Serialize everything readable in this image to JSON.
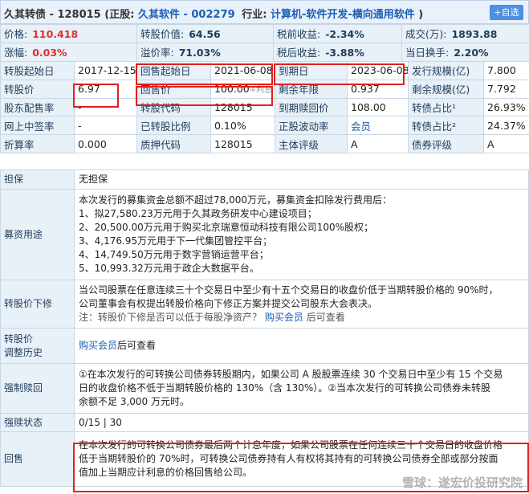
{
  "header": {
    "bond_name": "久其转债 - 128015",
    "stock_prefix": "(正股:",
    "stock": "久其软件 - 002279",
    "industry_label": "行业:",
    "industry": "计算机-软件开发-横向通用软件",
    "industry_suffix": ")",
    "add_watch": "+自选"
  },
  "quote_rows": [
    [
      {
        "l": "价格:",
        "v": "110.418",
        "c": "red"
      },
      {
        "l": "转股价值:",
        "v": "64.56"
      },
      {
        "l": "税前收益:",
        "v": "-2.34%"
      },
      {
        "l": "成交(万):",
        "v": "1893.88"
      }
    ],
    [
      {
        "l": "涨幅:",
        "v": "0.03%",
        "c": "red"
      },
      {
        "l": "溢价率:",
        "v": "71.03%"
      },
      {
        "l": "税后收益:",
        "v": "-3.88%"
      },
      {
        "l": "当日换手:",
        "v": "2.20%"
      }
    ]
  ],
  "info_rows": [
    [
      "转股起始日",
      "2017-12-15",
      "回售起始日",
      "2021-06-08",
      "到期日",
      "2023-06-08",
      "发行规模(亿)",
      "7.800"
    ],
    [
      "转股价",
      "6.97",
      "回售价",
      "100.00",
      "剩余年限",
      "0.937",
      "剩余规模(亿)",
      "7.792"
    ],
    [
      "股东配售率",
      "-",
      "转股代码",
      "128015",
      "到期赎回价",
      "108.00",
      "转债占比¹",
      "26.93%"
    ],
    [
      "网上中签率",
      "-",
      "已转股比例",
      "0.10%",
      "正股波动率",
      "会员",
      "转债占比²",
      "24.37%"
    ],
    [
      "折算率",
      "0.000",
      "质押代码",
      "128015",
      "主体评级",
      "A",
      "债券评级",
      "A"
    ]
  ],
  "put_price_suffix": "+利息",
  "desc": {
    "guarantee_label": "担保",
    "guarantee": "无担保",
    "funds_label": "募资用途",
    "funds": [
      "本次发行的募集资金总额不超过78,000万元，募集资金扣除发行费用后：",
      "1、拟27,580.23万元用于久其政务研发中心建设项目；",
      "2、20,500.00万元用于购买北京瑞意恒动科技有限公司100%股权；",
      "3、4,176.95万元用于下一代集团管控平台；",
      "4、14,749.50万元用于数字营销运营平台；",
      "5、10,993.32万元用于政企大数据平台。"
    ],
    "reset_label": "转股价下修",
    "reset_lines": [
      "当公司股票在任意连续三十个交易日中至少有十五个交易日的收盘价低于当期转股价格的 90%时，",
      "公司董事会有权提出转股价格向下修正方案并提交公司股东大会表决。"
    ],
    "reset_note_prefix": "注：转股价下修是否可以低于每股净资产？",
    "reset_note_link": "购买会员",
    "reset_note_suffix": "后可查看",
    "history_label_1": "转股价",
    "history_label_2": "调整历史",
    "history_link": "购买会员",
    "history_suffix": "后可查看",
    "redeem_label": "强制赎回",
    "redeem_lines": [
      "①在本次发行的可转换公司债券转股期内，如果公司 A 股股票连续 30 个交易日中至少有 15 个交易",
      "日的收盘价格不低于当期转股价格的 130%（含 130%）。②当本次发行的可转换公司债券未转股",
      "余额不足 3,000 万元时。"
    ],
    "redeem_status_label": "强赎状态",
    "redeem_status": "0/15 | 30",
    "put_label": "回售",
    "put_lines": [
      "在本次发行的可转换公司债券最后两个计息年度，如果公司股票在任何连续三十个交易日的收盘价格",
      "低于当期转股价的 70%时，可转换公司债券持有人有权将其持有的可转换公司债券全部或部分按面",
      "值加上当期应计利息的价格回售给公司。"
    ]
  },
  "watermark": "雪球：遂宏价投研究院",
  "colors": {
    "accent": "#1a5fb4",
    "red": "#e0302e",
    "label_bg": "#e8f0f8",
    "highlight": "#e02020"
  }
}
